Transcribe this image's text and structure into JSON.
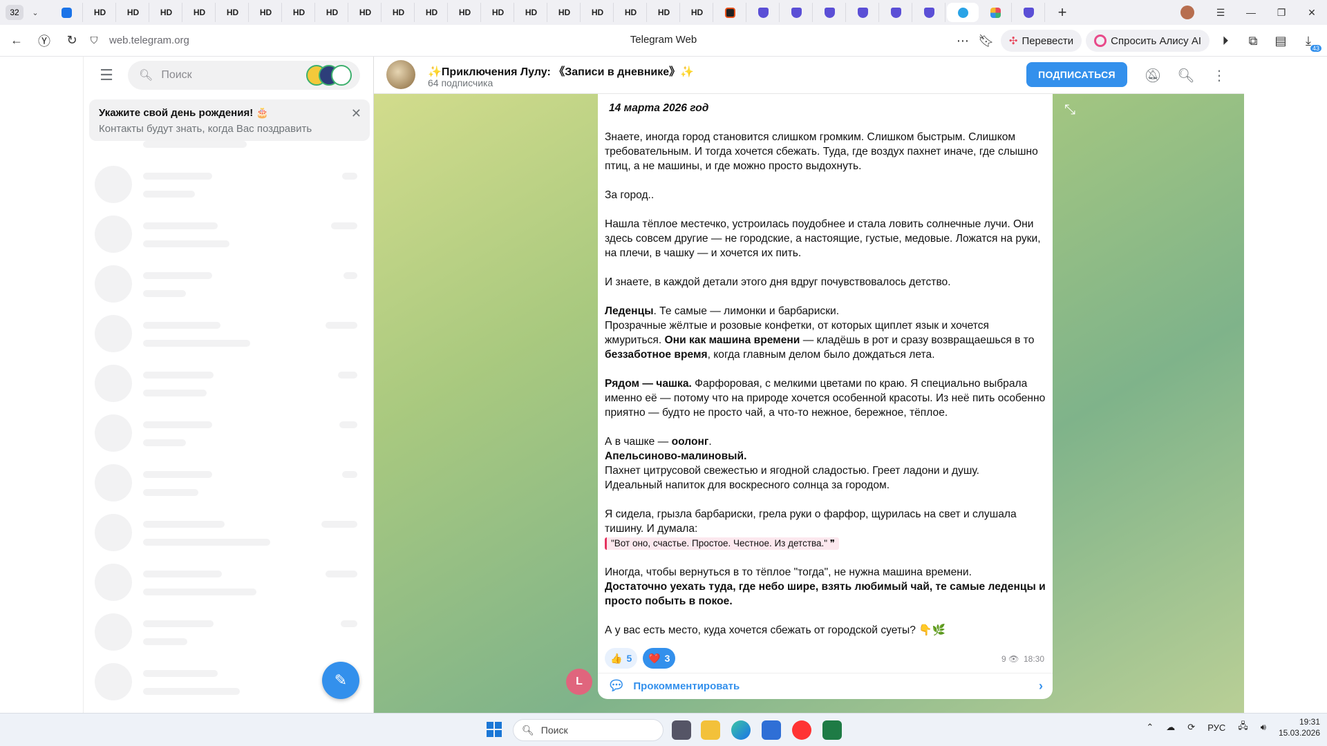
{
  "browser": {
    "tab_count": "32",
    "tab_label": "HD",
    "url": "web.telegram.org",
    "page_title": "Telegram Web",
    "translate_label": "Перевести",
    "alice_label": "Спросить Алису AI",
    "downloads_badge": "43",
    "colors": {
      "accent": "#3390ec"
    }
  },
  "sidebar": {
    "search_placeholder": "Поиск",
    "birthday_title": "Укажите свой день рождения! 🎂",
    "birthday_sub": "Контакты будут знать, когда Вас поздравить"
  },
  "chat": {
    "title": "✨Приключения Лулу: 《Записи в дневнике》✨",
    "subscribers": "64 подписчика",
    "subscribe_button": "ПОДПИСАТЬСЯ",
    "post": {
      "date": "14 марта 2026 год",
      "p1": "Знаете, иногда город становится слишком громким. Слишком быстрым. Слишком требовательным. И тогда хочется сбежать. Туда, где воздух пахнет иначе, где слышно птиц, а не машины, и где можно просто выдохнуть.",
      "p2": "За город..",
      "p3": "Нашла тёплое местечко, устроилась поудобнее и стала ловить солнечные лучи. Они здесь совсем другие — не городские, а настоящие, густые, медовые. Ложатся на руки, на плечи, в чашку — и хочется их пить.",
      "p4": "И знаете, в каждой детали этого дня вдруг почувствовалось детство.",
      "p5_b1": "Леденцы",
      "p5_t1": ". Те самые — лимонки и барбариски.",
      "p5_t2": "Прозрачные жёлтые и розовые конфетки, от которых щиплет язык и хочется жмуриться. ",
      "p5_b2": "Они как машина времени",
      "p5_t3": " — кладёшь в рот и сразу возвращаешься в то ",
      "p5_b3": "беззаботное время",
      "p5_t4": ", когда главным делом было дождаться лета.",
      "p6_b": "Рядом — чашка.",
      "p6_t": " Фарфоровая, с мелкими цветами по краю. Я специально выбрала именно её — потому что на природе хочется особенной красоты. Из неё пить особенно приятно — будто не просто чай, а что-то нежное, бережное, тёплое.",
      "p7_t1": "А в чашке — ",
      "p7_b1": "оолонг",
      "p7_t2": ".",
      "p7_b2": "Апельсиново-малиновый.",
      "p7_t3": "Пахнет цитрусовой свежестью и ягодной сладостью. Греет ладони и душу.",
      "p7_t4": "Идеальный напиток для воскресного солнца за городом.",
      "p8": "Я сидела, грызла барбариски, грела руки о фарфор, щурилась на свет и слушала тишину. И думала:",
      "quote": "\"Вот оно, счастье. Простое. Честное. Из детства.\" ❞",
      "p9_t": "Иногда, чтобы вернуться в то тёплое \"тогда\", не нужна машина времени.",
      "p9_b": "Достаточно уехать туда, где небо шире, взять любимый чай, те самые леденцы и просто побыть в покое.",
      "p10": "А у вас есть место, куда хочется сбежать от городской суеты? 👇🌿",
      "reaction1_emoji": "👍",
      "reaction1_count": "5",
      "reaction2_emoji": "❤️",
      "reaction2_count": "3",
      "views": "9",
      "time": "18:30",
      "comment_label": "Прокомментировать",
      "commenter_initial": "L"
    }
  },
  "taskbar": {
    "search_placeholder": "Поиск",
    "lang": "РУС",
    "time": "19:31",
    "date": "15.03.2026"
  }
}
